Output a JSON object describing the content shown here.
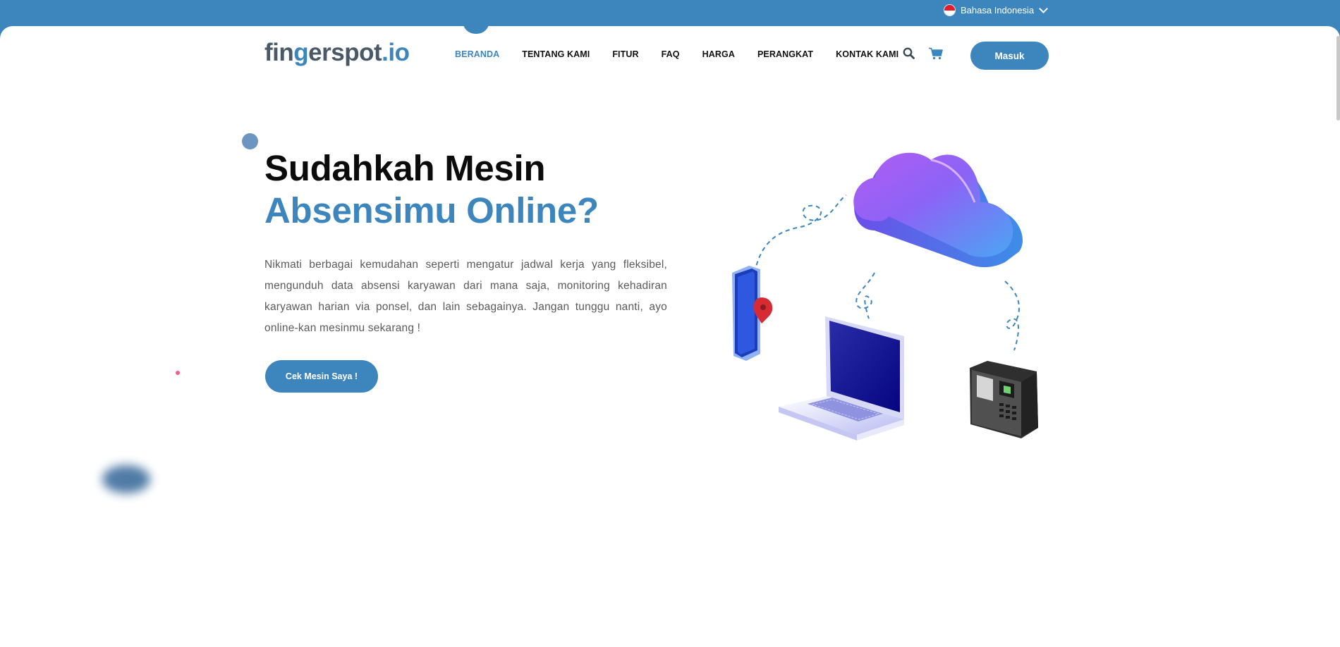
{
  "topbar": {
    "language": "Bahasa Indonesia"
  },
  "logo": {
    "part1": "fin",
    "part2": "g",
    "part3": "erspot",
    "part4": ".io"
  },
  "nav": {
    "items": [
      {
        "label": "BERANDA"
      },
      {
        "label": "TENTANG KAMI"
      },
      {
        "label": "FITUR"
      },
      {
        "label": "FAQ"
      },
      {
        "label": "HARGA"
      },
      {
        "label": "PERANGKAT"
      },
      {
        "label": "KONTAK KAMI"
      }
    ],
    "login_label": "Masuk"
  },
  "hero": {
    "title_line1": "Sudahkah Mesin",
    "title_line2": "Absensimu Online?",
    "description": "Nikmati berbagai kemudahan seperti mengatur jadwal kerja yang fleksibel, mengunduh data absensi karyawan dari mana saja, monitoring kehadiran karyawan harian via ponsel, dan lain sebagainya. Jangan tunggu nanti, ayo online-kan mesinmu sekarang !",
    "cta_label": "Cek Mesin Saya !"
  },
  "colors": {
    "brand": "#3d86bd",
    "logo_dark": "#4a5968",
    "cloud_start": "#a45cf5",
    "cloud_end": "#3aa8f0"
  },
  "icons": [
    "flag-indonesia-icon",
    "chevron-down-icon",
    "search-icon",
    "cart-icon",
    "cloud-icon",
    "phone-icon",
    "location-pin-icon",
    "laptop-icon",
    "fingerprint-machine-icon"
  ]
}
